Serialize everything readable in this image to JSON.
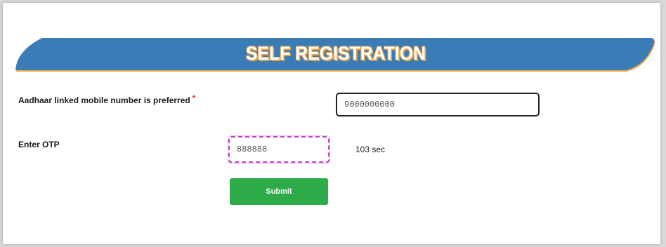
{
  "header": {
    "title": "SELF REGISTRATION"
  },
  "form": {
    "mobile": {
      "label": "Aadhaar linked mobile number is preferred",
      "required_mark": "*",
      "value": "9000000000"
    },
    "otp": {
      "label": "Enter OTP",
      "value": "888888",
      "timer": "103 sec"
    },
    "submit_label": "Submit"
  },
  "colors": {
    "banner_blue": "#3a7db6",
    "banner_accent": "#e7a24a",
    "submit_green": "#2cab48",
    "otp_border": "#c043c9",
    "required": "#e02020"
  }
}
